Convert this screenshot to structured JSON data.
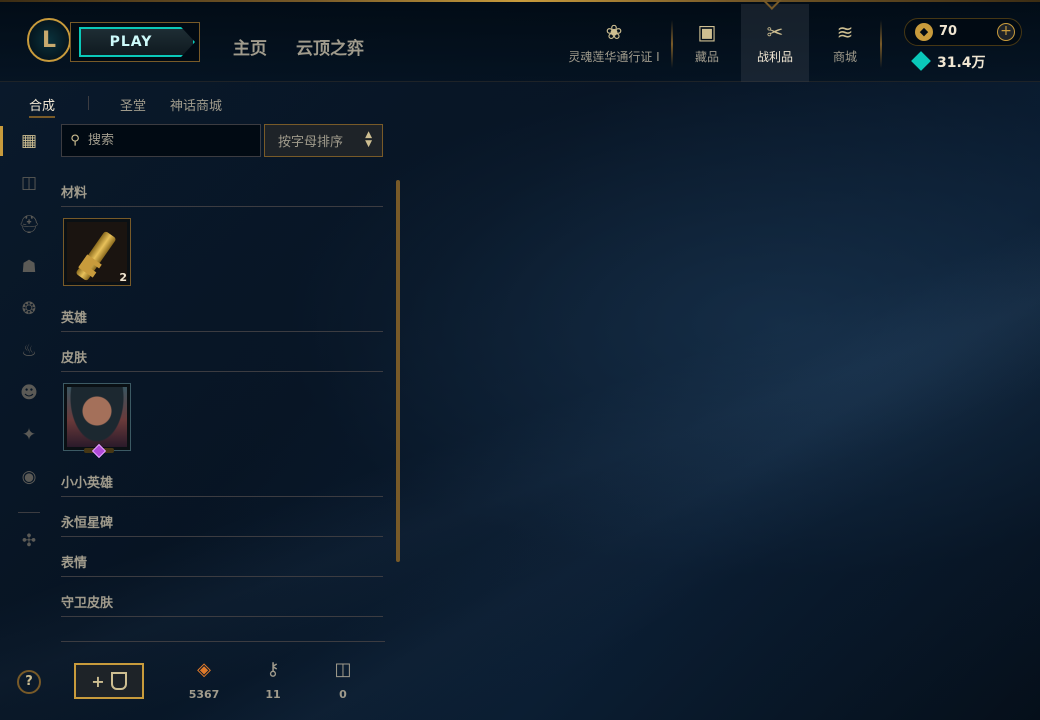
{
  "topbar": {
    "logo_text": "L",
    "play_label": "PLAY",
    "nav_links": [
      "主页",
      "云顶之弈"
    ],
    "nav_items": [
      {
        "label": "灵魂莲华通行证 I",
        "icon": "lotus-icon"
      },
      {
        "label": "藏品",
        "icon": "collection-bag-icon"
      },
      {
        "label": "战利品",
        "icon": "loot-icon"
      },
      {
        "label": "商城",
        "icon": "store-coins-icon"
      }
    ],
    "rp": "70",
    "be": "31.4万",
    "plus": "+"
  },
  "subtabs": [
    "合成",
    "圣堂",
    "神话商城"
  ],
  "search": {
    "placeholder": "搜索"
  },
  "sort": {
    "label": "按字母排序"
  },
  "sections": {
    "materials": "材料",
    "champions": "英雄",
    "skins": "皮肤",
    "tacticians": "小小英雄",
    "eternals": "永恒星碑",
    "emotes": "表情",
    "ward_skins": "守卫皮肤"
  },
  "items": {
    "key_fragment_count": "2"
  },
  "bottom": {
    "craft_plus": "+",
    "orange_essence": "5367",
    "keys": "11",
    "chests": "0"
  },
  "help": "?",
  "colors": {
    "gold": "#c89b3c",
    "teal": "#0ac8b9",
    "background": "#010a13"
  }
}
